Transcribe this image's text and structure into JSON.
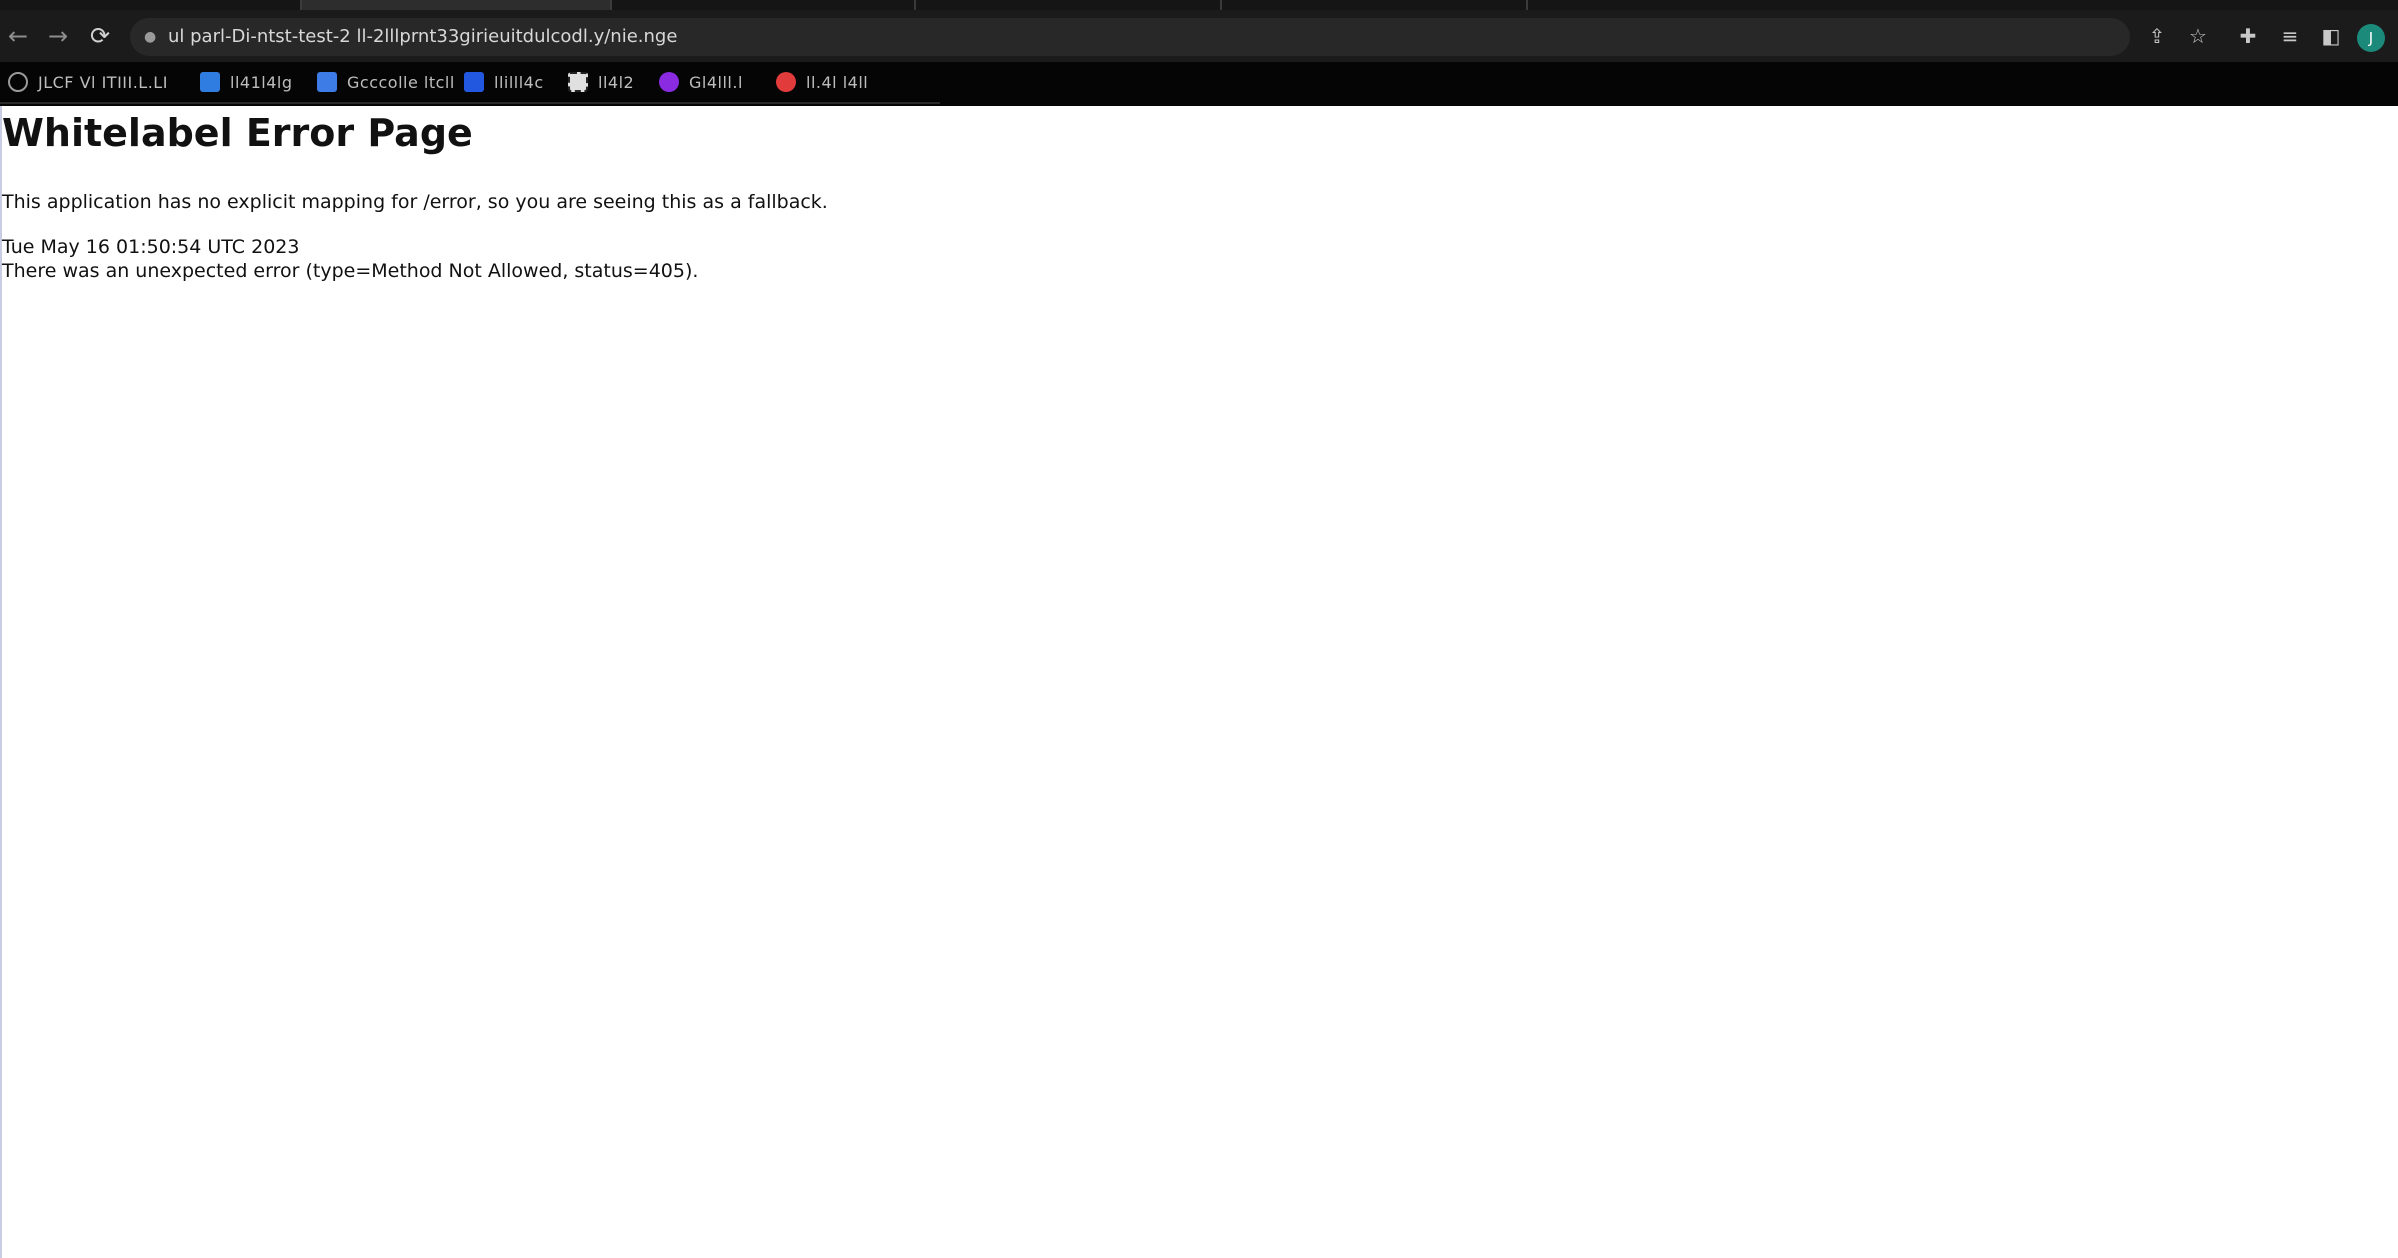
{
  "browser": {
    "url": "ul  parl-Di-ntst-test-2 ll-2lllprnt33girieuitdulcodl.y/nie.nge",
    "avatar_initial": "J",
    "icons": {
      "back": "arrow-left-icon",
      "forward": "arrow-right-icon",
      "reload": "reload-icon",
      "share": "share-icon",
      "bookmark": "star-icon",
      "extensions": "puzzle-icon",
      "reading_list": "reading-list-icon",
      "side_panel": "side-panel-icon"
    }
  },
  "bookmarks": [
    {
      "label": "JLCF Vl ITIII.L.LI",
      "color": "#9a9a9a"
    },
    {
      "label": "ll41l4lg",
      "color": "#2f7de1"
    },
    {
      "label": "Gcccolle ltcll",
      "color": "#3d7be6"
    },
    {
      "label": "llilll4c",
      "color": "#2257e0"
    },
    {
      "label": "ll4l2",
      "color": "#9a9a9a"
    },
    {
      "label": "Gl4lll.l",
      "color": "#8a2be2"
    },
    {
      "label": "ll.4l l4ll",
      "color": "#e23b3b"
    }
  ],
  "page": {
    "title": "Whitelabel Error Page",
    "message": "This application has no explicit mapping for /error, so you are seeing this as a fallback.",
    "timestamp": "Tue May 16 01:50:54 UTC 2023",
    "error": "There was an unexpected error (type=Method Not Allowed, status=405)."
  }
}
